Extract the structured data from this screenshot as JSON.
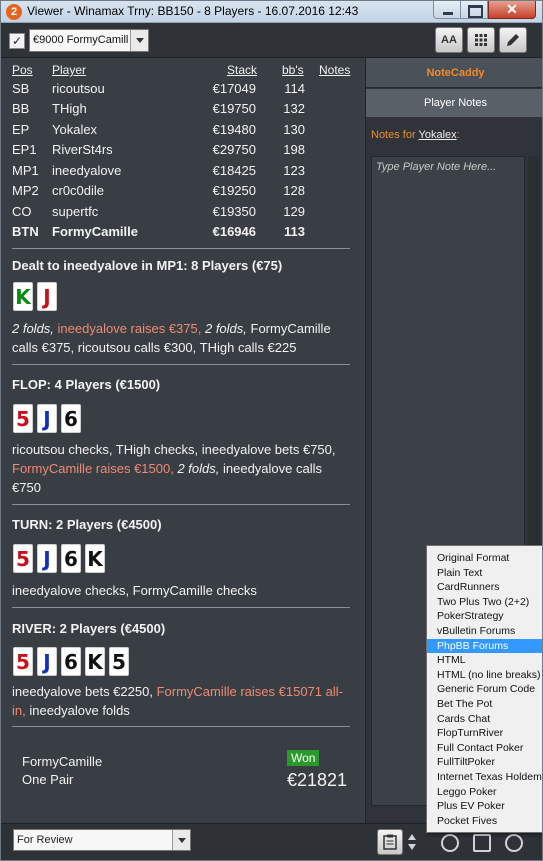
{
  "window": {
    "title": "Viewer - Winamax Trny: BB150 - 8 Players - 16.07.2016 12:43",
    "app_icon_glyph": "2"
  },
  "toolbar": {
    "hero_select_value": "€9000 FormyCamill",
    "font_button_label": "AA"
  },
  "seats": {
    "headers": {
      "pos": "Pos",
      "player": "Player",
      "stack": "Stack",
      "bb": "bb's",
      "notes": "Notes"
    },
    "rows": [
      {
        "pos": "SB",
        "player": "ricoutsou",
        "stack": "€17049",
        "bb": "114"
      },
      {
        "pos": "BB",
        "player": "THigh",
        "stack": "€19750",
        "bb": "132"
      },
      {
        "pos": "EP",
        "player": "Yokalex",
        "stack": "€19480",
        "bb": "130"
      },
      {
        "pos": "EP1",
        "player": "RiverSt4rs",
        "stack": "€29750",
        "bb": "198"
      },
      {
        "pos": "MP1",
        "player": "ineedyalove",
        "stack": "€18425",
        "bb": "123"
      },
      {
        "pos": "MP2",
        "player": "cr0c0dile",
        "stack": "€19250",
        "bb": "128"
      },
      {
        "pos": "CO",
        "player": "supertfc",
        "stack": "€19350",
        "bb": "129"
      },
      {
        "pos": "BTN",
        "player": "FormyCamille",
        "stack": "€16946",
        "bb": "113"
      }
    ]
  },
  "preflop": {
    "title": "Dealt to ineedyalove in MP1: 8 Players (€75)",
    "cards": [
      "K",
      "J"
    ],
    "action": {
      "a1": "2 folds,",
      "a2": " ineedyalove raises €375,",
      "a3": " 2 folds,",
      "a4": " FormyCamille calls €375, ricoutsou calls €300, THigh calls €225"
    }
  },
  "flop": {
    "title": "FLOP: 4 Players (€1500)",
    "cards": [
      "5",
      "J",
      "6"
    ],
    "action": {
      "a1": "ricoutsou checks, THigh checks, ineedyalove bets €750,",
      "a2": " FormyCamille raises €1500,",
      "a3": " 2 folds,",
      "a4": " ineedyalove calls €750"
    }
  },
  "turn": {
    "title": "TURN: 2 Players (€4500)",
    "cards": [
      "5",
      "J",
      "6",
      "K"
    ],
    "action": "ineedyalove checks, FormyCamille checks"
  },
  "river": {
    "title": "RIVER: 2 Players (€4500)",
    "cards": [
      "5",
      "J",
      "6",
      "K",
      "5"
    ],
    "action": {
      "a1": "ineedyalove bets €2250,",
      "a2": " FormyCamille raises €15071 all-in,",
      "a3": " ineedyalove folds"
    }
  },
  "summary": {
    "winner": "FormyCamille",
    "hand": "One Pair",
    "badge": "Won",
    "amount": "€21821"
  },
  "notecaddy": {
    "tab_label": "NoteCaddy",
    "notes_tab_label": "Player Notes",
    "notes_for_label": "Notes for",
    "notes_for_player": "Yokalex",
    "notes_for_suffix": ":",
    "placeholder": "Type Player Note Here..."
  },
  "bottom": {
    "review_value": "For Review"
  },
  "format_menu": {
    "selected_index": 6,
    "items": [
      "Original Format",
      "Plain Text",
      "CardRunners",
      "Two Plus Two (2+2)",
      "PokerStrategy",
      "vBulletin Forums",
      "PhpBB Forums",
      "HTML",
      "HTML (no line breaks)",
      "Generic Forum Code",
      "Bet The Pot",
      "Cards Chat",
      "FlopTurnRiver",
      "Full Contact Poker",
      "FullTiltPoker",
      "Internet Texas Holdem",
      "Leggo Poker",
      "Plus EV Poker",
      "Pocket Fives"
    ]
  },
  "colors": {
    "highlight_action": "#f08a72",
    "notecaddy_orange": "#f08a2a",
    "won_green": "#2a9a2a",
    "menu_selection": "#3399ff"
  }
}
